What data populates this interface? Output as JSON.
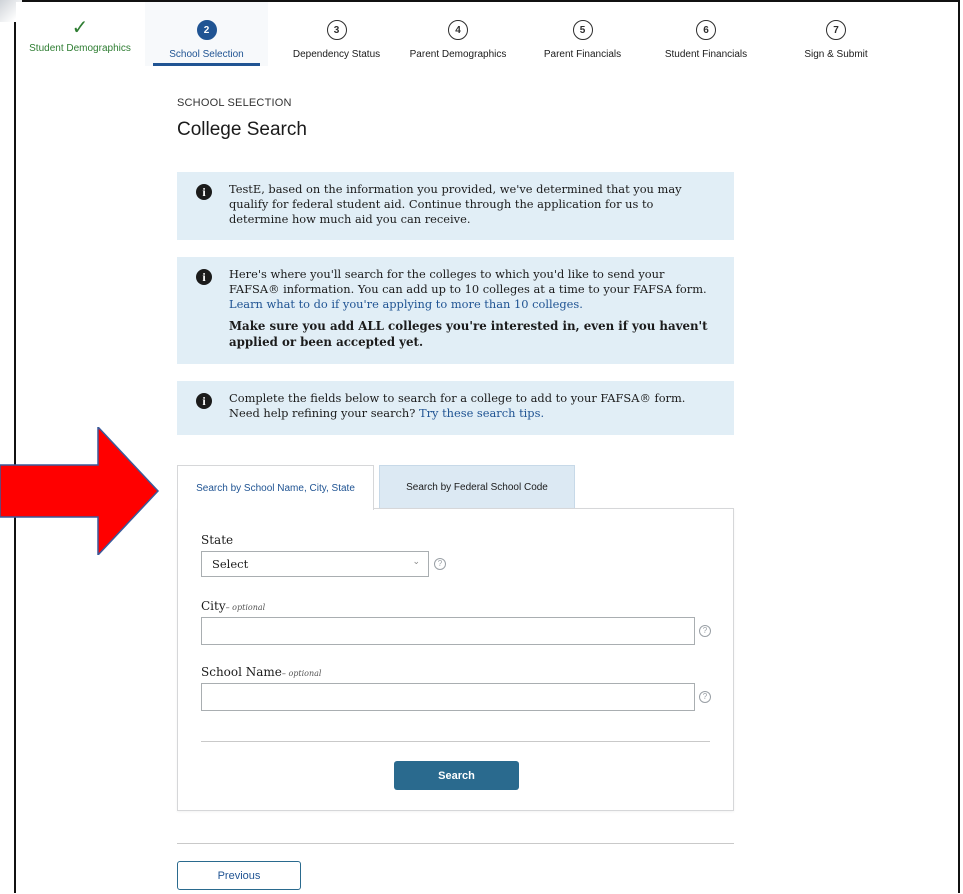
{
  "stepper": {
    "steps": [
      {
        "number": "",
        "label": "Student Demographics",
        "state": "completed"
      },
      {
        "number": "2",
        "label": "School Selection",
        "state": "active"
      },
      {
        "number": "3",
        "label": "Dependency Status",
        "state": "upcoming"
      },
      {
        "number": "4",
        "label": "Parent Demographics",
        "state": "upcoming"
      },
      {
        "number": "5",
        "label": "Parent Financials",
        "state": "upcoming"
      },
      {
        "number": "6",
        "label": "Student Financials",
        "state": "upcoming"
      },
      {
        "number": "7",
        "label": "Sign & Submit",
        "state": "upcoming"
      }
    ],
    "check_icon": "checkmark-icon"
  },
  "header": {
    "eyebrow": "SCHOOL SELECTION",
    "title": "College Search"
  },
  "alerts": {
    "qualify": {
      "text": "TestE, based on the information you provided, we've determined that you may qualify for federal student aid. Continue through the application for us to determine how much aid you can receive."
    },
    "search_intro": {
      "text": "Here's where you'll search for the colleges to which you'd like to send your FAFSA® information. You can add up to 10 colleges at a time to your FAFSA form. ",
      "link": "Learn what to do if you're applying to more than 10 colleges.",
      "bold": "Make sure you add ALL colleges you're interested in, even if you haven't applied or been accepted yet."
    },
    "search_help": {
      "text": "Complete the fields below to search for a college to add to your FAFSA® form. Need help refining your search? ",
      "link": "Try these search tips."
    }
  },
  "tabs": {
    "by_name": "Search by School Name, City, State",
    "by_code": "Search by Federal School Code"
  },
  "form": {
    "state_label": "State",
    "state_value": "Select",
    "city_label": "City",
    "school_label": "School Name",
    "optional_suffix": "– optional",
    "help_glyph": "?"
  },
  "buttons": {
    "search": "Search",
    "previous": "Previous"
  },
  "colors": {
    "primary": "#205493",
    "button": "#2a6a8e",
    "alert_bg": "#e1eef6",
    "complete": "#2e7d32",
    "arrow": "#ff0000"
  }
}
